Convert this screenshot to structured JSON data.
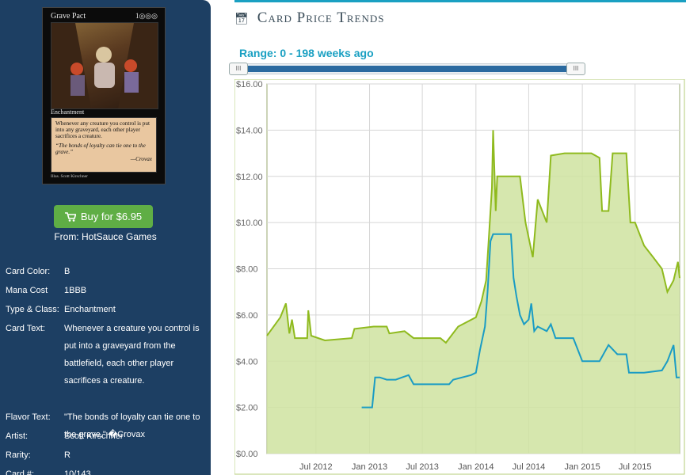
{
  "card": {
    "name": "Grave Pact",
    "mana_symbols": "1◎◎◎",
    "type_line": "Enchantment",
    "rules_text": "Whenever any creature you control is put into any graveyard, each other player sacrifices a creature.",
    "flavor": "“The bonds of loyalty can tie one to the grave.”",
    "flavor_sig": "—Crovax",
    "illus": "Illus. Scott Kirschner"
  },
  "buy": {
    "label": "Buy for $6.95",
    "icon": "cart-icon"
  },
  "from": "From: HotSauce Games",
  "details": [
    {
      "key": "Card Color:",
      "value": "B"
    },
    {
      "key": "Mana Cost",
      "value": "1BBB"
    },
    {
      "key": "Type & Class:",
      "value": "Enchantment"
    },
    {
      "key": "Card Text:",
      "value": "Whenever a creature you control is put into a graveyard from the battlefield, each other player sacrifices a creature."
    },
    {
      "key": "Flavor Text:",
      "value": "\"The bonds of loyalty can tie one to the grave.\" �Crovax"
    },
    {
      "key": "Artist:",
      "value": "Scott Kirschner"
    },
    {
      "key": "Rarity:",
      "value": "R"
    },
    {
      "key": "Card #:",
      "value": "10/143"
    }
  ],
  "header": {
    "title": "Card Price Trends",
    "icon": "calendar-icon"
  },
  "range": {
    "label": "Range: 0 - 198 weeks ago"
  },
  "colors": {
    "sidebar": "#1d3f63",
    "accent": "#1aa0c2",
    "green_line": "#8fba1e",
    "green_fill": "#cfe3a0",
    "blue_line": "#1a9cc4",
    "button": "#5fae45"
  },
  "chart_data": {
    "type": "area",
    "ylim": [
      0,
      16
    ],
    "y_ticks": [
      "$0.00",
      "$2.00",
      "$4.00",
      "$6.00",
      "$8.00",
      "$10.00",
      "$12.00",
      "$14.00",
      "$16.00"
    ],
    "x_ticks": [
      "Jul 2012",
      "Jan 2013",
      "Jul 2013",
      "Jan 2014",
      "Jul 2014",
      "Jan 2015",
      "Jul 2015"
    ],
    "x_range": [
      "2012-01-15",
      "2015-12-01"
    ],
    "series": [
      {
        "name": "",
        "values": [
          [
            "2012-01-15",
            5.1
          ],
          [
            "2012-03-01",
            5.9
          ],
          [
            "2012-03-20",
            6.5
          ],
          [
            "2012-04-01",
            5.2
          ],
          [
            "2012-04-10",
            5.8
          ],
          [
            "2012-04-20",
            5.0
          ],
          [
            "2012-06-01",
            5.0
          ],
          [
            "2012-06-05",
            6.2
          ],
          [
            "2012-06-15",
            5.1
          ],
          [
            "2012-08-01",
            4.9
          ],
          [
            "2012-11-01",
            5.0
          ],
          [
            "2012-11-10",
            5.4
          ],
          [
            "2013-01-15",
            5.5
          ],
          [
            "2013-03-01",
            5.5
          ],
          [
            "2013-03-10",
            5.2
          ],
          [
            "2013-05-01",
            5.3
          ],
          [
            "2013-06-01",
            5.0
          ],
          [
            "2013-09-01",
            5.0
          ],
          [
            "2013-09-20",
            4.8
          ],
          [
            "2013-11-01",
            5.5
          ],
          [
            "2014-01-01",
            5.9
          ],
          [
            "2014-01-20",
            6.6
          ],
          [
            "2014-02-05",
            7.5
          ],
          [
            "2014-02-15",
            9.5
          ],
          [
            "2014-02-25",
            11.5
          ],
          [
            "2014-03-01",
            14.0
          ],
          [
            "2014-03-10",
            10.5
          ],
          [
            "2014-03-15",
            12.0
          ],
          [
            "2014-06-01",
            12.0
          ],
          [
            "2014-06-20",
            10.0
          ],
          [
            "2014-07-15",
            8.5
          ],
          [
            "2014-08-01",
            11.0
          ],
          [
            "2014-09-01",
            10.0
          ],
          [
            "2014-09-15",
            12.9
          ],
          [
            "2014-11-01",
            13.0
          ],
          [
            "2014-12-01",
            13.0
          ],
          [
            "2015-02-01",
            13.0
          ],
          [
            "2015-03-01",
            12.8
          ],
          [
            "2015-03-10",
            10.5
          ],
          [
            "2015-04-01",
            10.5
          ],
          [
            "2015-04-15",
            13.0
          ],
          [
            "2015-06-01",
            13.0
          ],
          [
            "2015-06-15",
            10.0
          ],
          [
            "2015-07-01",
            10.0
          ],
          [
            "2015-08-01",
            9.0
          ],
          [
            "2015-09-01",
            8.5
          ],
          [
            "2015-10-01",
            8.0
          ],
          [
            "2015-10-20",
            7.0
          ],
          [
            "2015-11-10",
            7.5
          ],
          [
            "2015-11-25",
            8.3
          ],
          [
            "2015-12-01",
            7.6
          ]
        ]
      },
      {
        "name": "",
        "values": [
          [
            "2012-12-05",
            2.0
          ],
          [
            "2013-01-10",
            2.0
          ],
          [
            "2013-01-20",
            3.3
          ],
          [
            "2013-02-05",
            3.3
          ],
          [
            "2013-03-01",
            3.2
          ],
          [
            "2013-04-01",
            3.2
          ],
          [
            "2013-05-15",
            3.4
          ],
          [
            "2013-06-01",
            3.0
          ],
          [
            "2013-10-01",
            3.0
          ],
          [
            "2013-10-15",
            3.2
          ],
          [
            "2013-12-15",
            3.4
          ],
          [
            "2014-01-01",
            3.5
          ],
          [
            "2014-01-15",
            4.5
          ],
          [
            "2014-02-01",
            5.5
          ],
          [
            "2014-02-10",
            7.0
          ],
          [
            "2014-02-20",
            9.2
          ],
          [
            "2014-03-01",
            9.5
          ],
          [
            "2014-04-15",
            9.5
          ],
          [
            "2014-05-01",
            9.5
          ],
          [
            "2014-05-10",
            7.6
          ],
          [
            "2014-05-20",
            6.8
          ],
          [
            "2014-06-01",
            6.0
          ],
          [
            "2014-06-15",
            5.6
          ],
          [
            "2014-07-01",
            5.8
          ],
          [
            "2014-07-10",
            6.5
          ],
          [
            "2014-07-20",
            5.3
          ],
          [
            "2014-08-01",
            5.5
          ],
          [
            "2014-09-01",
            5.3
          ],
          [
            "2014-09-15",
            5.6
          ],
          [
            "2014-10-01",
            5.0
          ],
          [
            "2014-12-01",
            5.0
          ],
          [
            "2015-01-01",
            4.0
          ],
          [
            "2015-03-01",
            4.0
          ],
          [
            "2015-04-01",
            4.7
          ],
          [
            "2015-05-01",
            4.3
          ],
          [
            "2015-06-01",
            4.3
          ],
          [
            "2015-06-10",
            3.5
          ],
          [
            "2015-08-01",
            3.5
          ],
          [
            "2015-10-01",
            3.6
          ],
          [
            "2015-10-20",
            4.0
          ],
          [
            "2015-11-10",
            4.7
          ],
          [
            "2015-11-20",
            3.3
          ],
          [
            "2015-12-01",
            3.3
          ]
        ]
      }
    ]
  }
}
